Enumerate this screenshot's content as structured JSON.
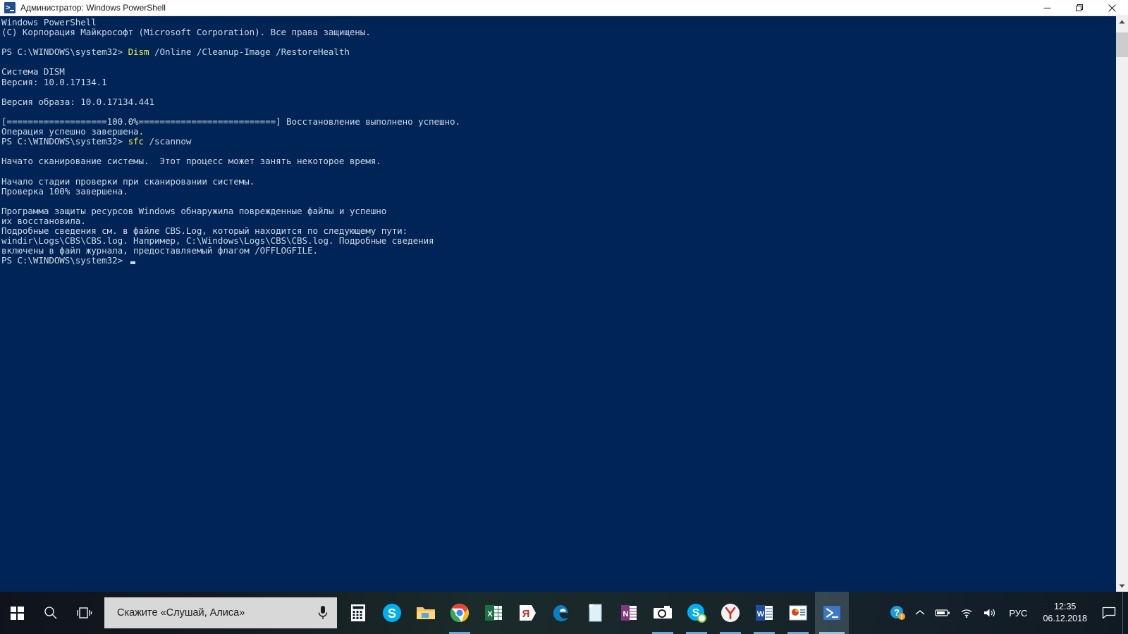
{
  "window": {
    "title": "Администратор: Windows PowerShell",
    "icon": "powershell-icon",
    "controls": {
      "minimize": "minimize-icon",
      "restore": "restore-icon",
      "close": "close-icon"
    }
  },
  "console": {
    "background_color": "#012456",
    "text_color": "#ccd8e4",
    "highlight_color": "#f3f34a",
    "lines": [
      {
        "text": "Windows PowerShell"
      },
      {
        "text": "(C) Корпорация Майкрософт (Microsoft Corporation). Все права защищены."
      },
      {
        "text": ""
      },
      {
        "prompt": "PS C:\\WINDOWS\\system32> ",
        "command": "Dism",
        "args": " /Online /Cleanup-Image /RestoreHealth"
      },
      {
        "text": ""
      },
      {
        "text": "Система DISM"
      },
      {
        "text": "Версия: 10.0.17134.1"
      },
      {
        "text": ""
      },
      {
        "text": "Версия образа: 10.0.17134.441"
      },
      {
        "text": ""
      },
      {
        "text": "[===================100.0%==========================] Восстановление выполнено успешно."
      },
      {
        "text": "Операция успешно завершена."
      },
      {
        "prompt": "PS C:\\WINDOWS\\system32> ",
        "command": "sfc",
        "args": " /scannow"
      },
      {
        "text": ""
      },
      {
        "text": "Начато сканирование системы.  Этот процесс может занять некоторое время."
      },
      {
        "text": ""
      },
      {
        "text": "Начало стадии проверки при сканировании системы."
      },
      {
        "text": "Проверка 100% завершена."
      },
      {
        "text": ""
      },
      {
        "text": "Программа защиты ресурсов Windows обнаружила поврежденные файлы и успешно"
      },
      {
        "text": "их восстановила."
      },
      {
        "text": "Подробные сведения см. в файле CBS.Log, который находится по следующему пути:"
      },
      {
        "text": "windir\\Logs\\CBS\\CBS.log. Например, C:\\Windows\\Logs\\CBS\\CBS.log. Подробные сведения"
      },
      {
        "text": "включены в файл журнала, предоставляемый флагом /OFFLOGFILE."
      },
      {
        "prompt": "PS C:\\WINDOWS\\system32> ",
        "command": "",
        "args": "",
        "cursor": true
      }
    ]
  },
  "scrollbar": {
    "up_arrow": "chevron-up-icon",
    "down_arrow": "chevron-down-icon",
    "thumb": "scrollbar-thumb"
  },
  "taskbar": {
    "start": "windows-logo-icon",
    "search": "search-icon",
    "task_view": "task-view-icon",
    "alice": {
      "placeholder": "Скажите «Слушай, Алиса»",
      "mic": "microphone-icon"
    },
    "apps": [
      {
        "name": "calculator",
        "label": "Калькулятор",
        "active": false,
        "open": false
      },
      {
        "name": "skype",
        "label": "Skype",
        "active": false,
        "open": false
      },
      {
        "name": "file-explorer",
        "label": "Проводник",
        "active": false,
        "open": false
      },
      {
        "name": "chrome",
        "label": "Google Chrome",
        "active": false,
        "open": true
      },
      {
        "name": "excel",
        "label": "Excel",
        "active": false,
        "open": false
      },
      {
        "name": "yandex",
        "label": "Яндекс",
        "active": false,
        "open": false
      },
      {
        "name": "edge",
        "label": "Microsoft Edge",
        "active": false,
        "open": false
      },
      {
        "name": "notepad",
        "label": "Блокнот",
        "active": false,
        "open": false
      },
      {
        "name": "onenote",
        "label": "OneNote",
        "active": false,
        "open": false
      },
      {
        "name": "camera",
        "label": "Камера",
        "active": false,
        "open": true
      },
      {
        "name": "skype-business",
        "label": "Skype для бизнеса",
        "active": false,
        "open": true
      },
      {
        "name": "yandex-browser",
        "label": "Яндекс.Браузер",
        "active": false,
        "open": true
      },
      {
        "name": "word",
        "label": "Word",
        "active": false,
        "open": true
      },
      {
        "name": "powerpoint",
        "label": "PowerPoint",
        "active": false,
        "open": true
      },
      {
        "name": "powershell",
        "label": "Windows PowerShell",
        "active": true,
        "open": true
      }
    ],
    "tray": {
      "help": "help-question-icon",
      "chevron": "chevron-up-icon",
      "battery": "battery-icon",
      "network": "wifi-icon",
      "volume": "volume-icon",
      "language": "РУС",
      "time": "12:35",
      "date": "06.12.2018",
      "notifications": "action-center-icon"
    }
  }
}
